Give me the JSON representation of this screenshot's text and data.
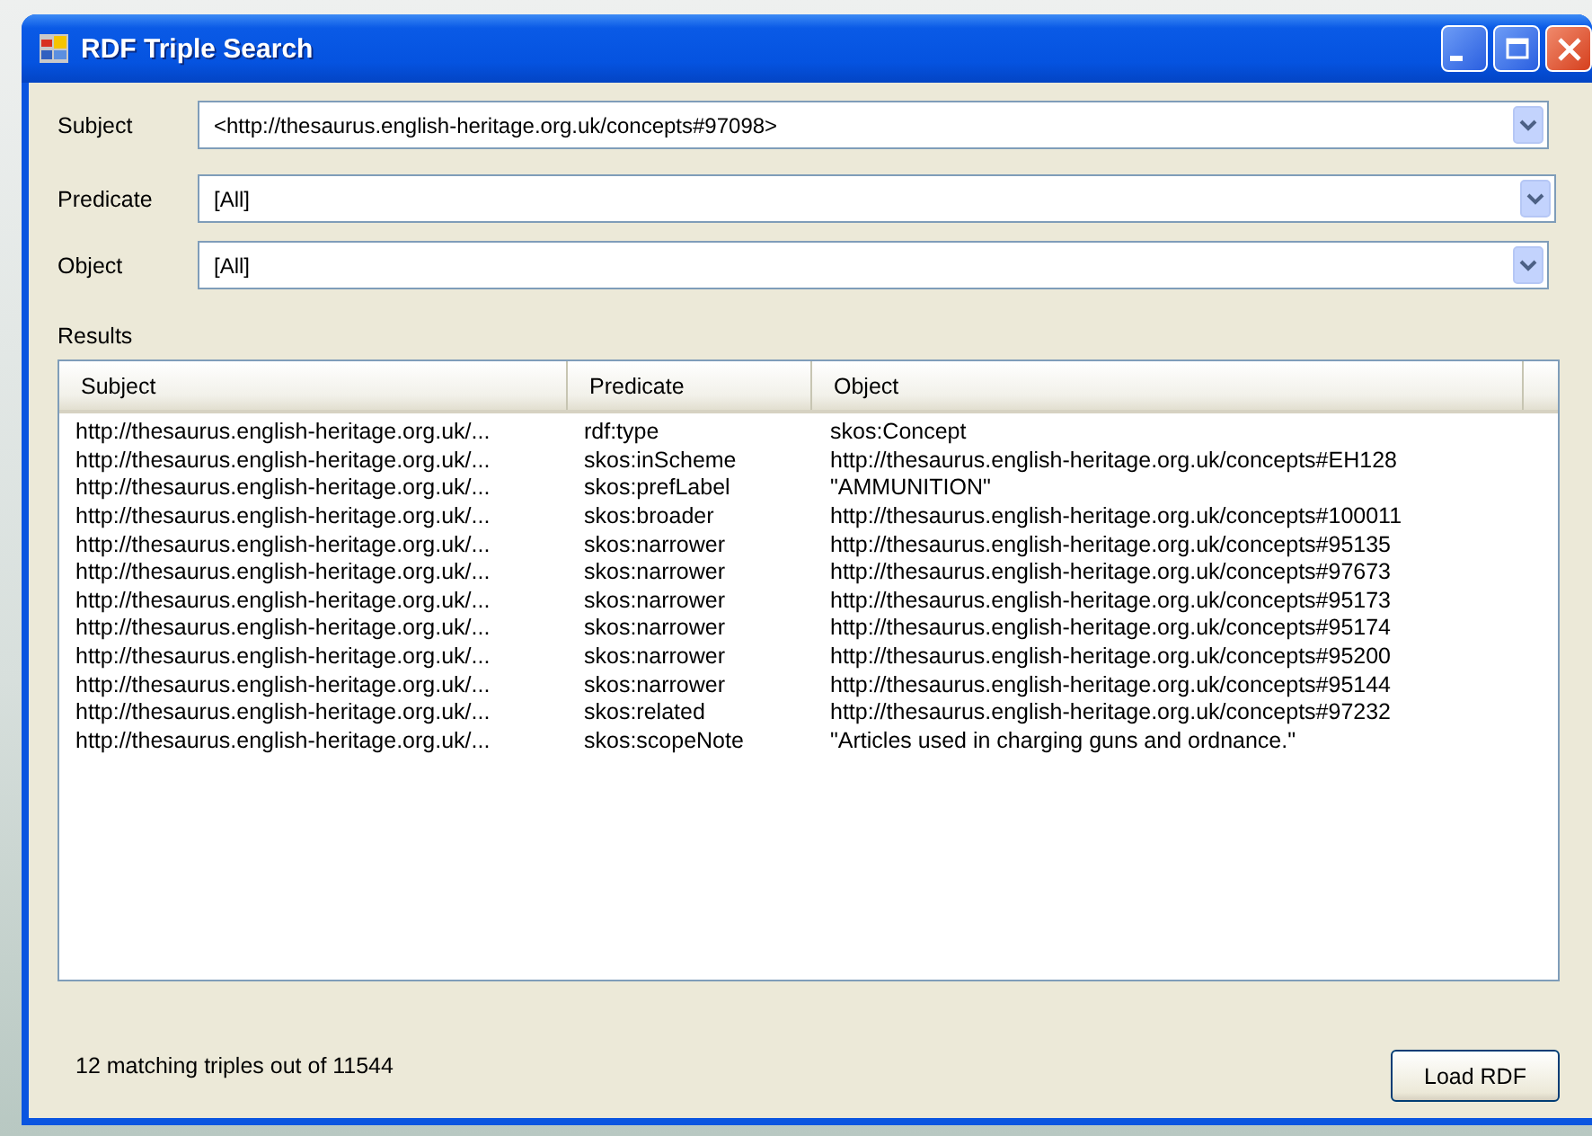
{
  "window": {
    "title": "RDF Triple Search"
  },
  "filters": [
    {
      "label": "Subject",
      "value": "<http://thesaurus.english-heritage.org.uk/concepts#97098>"
    },
    {
      "label": "Predicate",
      "value": "[All]"
    },
    {
      "label": "Object",
      "value": "[All]"
    }
  ],
  "results_label": "Results",
  "table": {
    "columns": [
      "Subject",
      "Predicate",
      "Object"
    ],
    "rows": [
      [
        "http://thesaurus.english-heritage.org.uk/...",
        "rdf:type",
        "skos:Concept"
      ],
      [
        "http://thesaurus.english-heritage.org.uk/...",
        "skos:inScheme",
        "http://thesaurus.english-heritage.org.uk/concepts#EH128"
      ],
      [
        "http://thesaurus.english-heritage.org.uk/...",
        "skos:prefLabel",
        "\"AMMUNITION\""
      ],
      [
        "http://thesaurus.english-heritage.org.uk/...",
        "skos:broader",
        "http://thesaurus.english-heritage.org.uk/concepts#100011"
      ],
      [
        "http://thesaurus.english-heritage.org.uk/...",
        "skos:narrower",
        "http://thesaurus.english-heritage.org.uk/concepts#95135"
      ],
      [
        "http://thesaurus.english-heritage.org.uk/...",
        "skos:narrower",
        "http://thesaurus.english-heritage.org.uk/concepts#97673"
      ],
      [
        "http://thesaurus.english-heritage.org.uk/...",
        "skos:narrower",
        "http://thesaurus.english-heritage.org.uk/concepts#95173"
      ],
      [
        "http://thesaurus.english-heritage.org.uk/...",
        "skos:narrower",
        "http://thesaurus.english-heritage.org.uk/concepts#95174"
      ],
      [
        "http://thesaurus.english-heritage.org.uk/...",
        "skos:narrower",
        "http://thesaurus.english-heritage.org.uk/concepts#95200"
      ],
      [
        "http://thesaurus.english-heritage.org.uk/...",
        "skos:narrower",
        "http://thesaurus.english-heritage.org.uk/concepts#95144"
      ],
      [
        "http://thesaurus.english-heritage.org.uk/...",
        "skos:related",
        "http://thesaurus.english-heritage.org.uk/concepts#97232"
      ],
      [
        "http://thesaurus.english-heritage.org.uk/...",
        "skos:scopeNote",
        "\"Articles used in charging guns and ordnance.\""
      ]
    ]
  },
  "status": "12 matching triples out of 11544",
  "buttons": [
    "Load RDF"
  ]
}
